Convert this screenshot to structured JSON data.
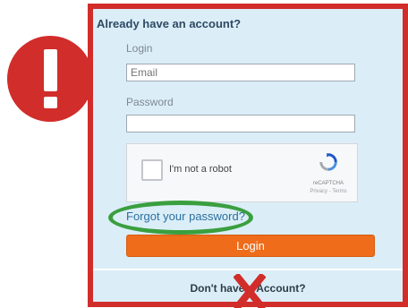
{
  "header": {
    "title": "Already have an account?"
  },
  "login_form": {
    "login_label": "Login",
    "email_placeholder": "Email",
    "password_label": "Password",
    "password_value": ""
  },
  "captcha": {
    "checkbox_label": "I'm not a robot",
    "brand": "reCAPTCHA",
    "links": "Privacy - Terms"
  },
  "actions": {
    "forgot_password": "Forgot your password?",
    "login_button": "Login"
  },
  "signup": {
    "prompt": "Don't have a Account?"
  },
  "colors": {
    "frame_red": "#d12d2a",
    "panel_blue": "#dbeef8",
    "button_orange": "#ee6c1a",
    "highlight_green": "#3a9f3f"
  },
  "icons": [
    "alert-icon",
    "recaptcha-icon",
    "x-icon"
  ]
}
